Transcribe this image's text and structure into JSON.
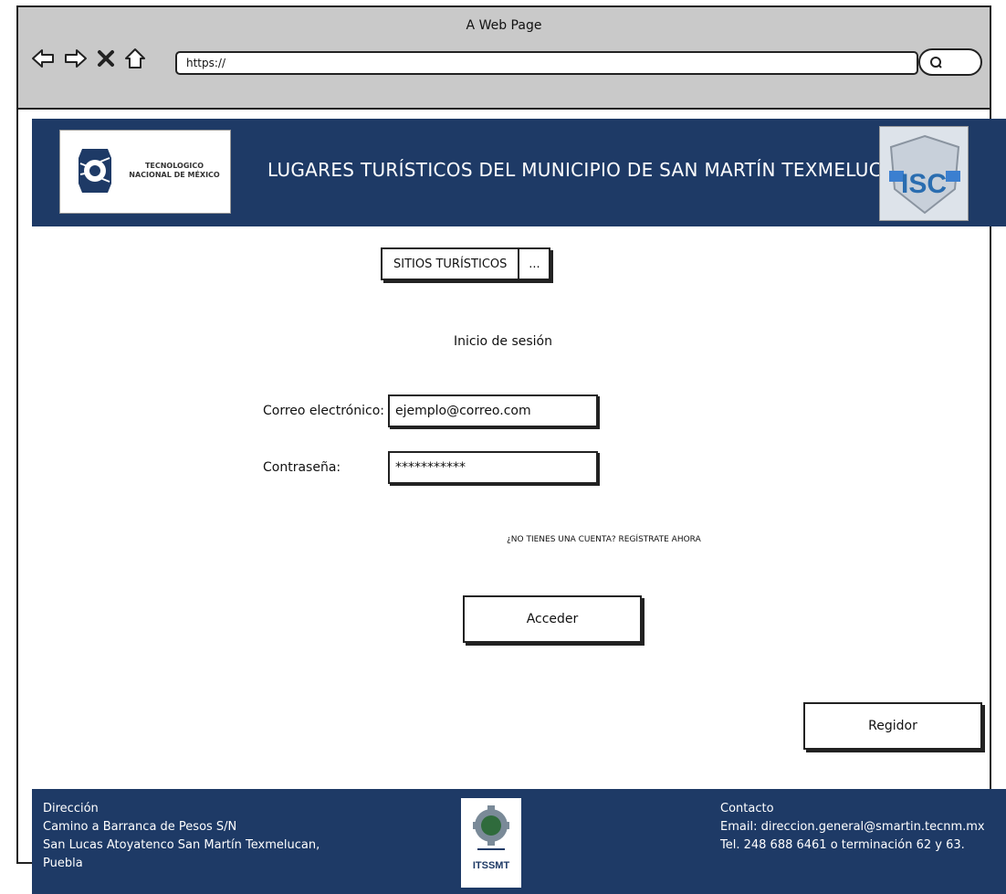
{
  "browser": {
    "title": "A Web Page",
    "url": "https://"
  },
  "header": {
    "title": "LUGARES TURÍSTICOS DEL MUNICIPIO DE SAN MARTÍN TEXMELUCAN",
    "left_logo_text": [
      "TECNOLOGICO",
      "NACIONAL DE MÉXICO"
    ],
    "right_logo_text": "ISC"
  },
  "nav": {
    "sites_label": "SITIOS TURÍSTICOS",
    "more_label": "..."
  },
  "login": {
    "title": "Inicio de sesión",
    "email_label": "Correo electrónico:",
    "email_value": "ejemplo@correo.com",
    "password_label": "Contraseña:",
    "password_value": "***********",
    "register_link": "¿NO TIENES UNA CUENTA? REGÍSTRATE AHORA",
    "submit_label": "Acceder"
  },
  "admin_button": "Regidor",
  "footer": {
    "direction_title": "Dirección",
    "address_lines": [
      "Camino a Barranca de Pesos S/N",
      "San Lucas Atoyatenco San Martín Texmelucan,",
      "Puebla"
    ],
    "logo_text": "ITSSMT",
    "contact_title": "Contacto",
    "email": "Email: direccion.general@smartin.tecnm.mx",
    "phone": "Tel. 248 688 6461 o terminación 62 y 63."
  },
  "colors": {
    "header_bg": "#1e3a66",
    "chrome_bg": "#c9c9c9"
  }
}
